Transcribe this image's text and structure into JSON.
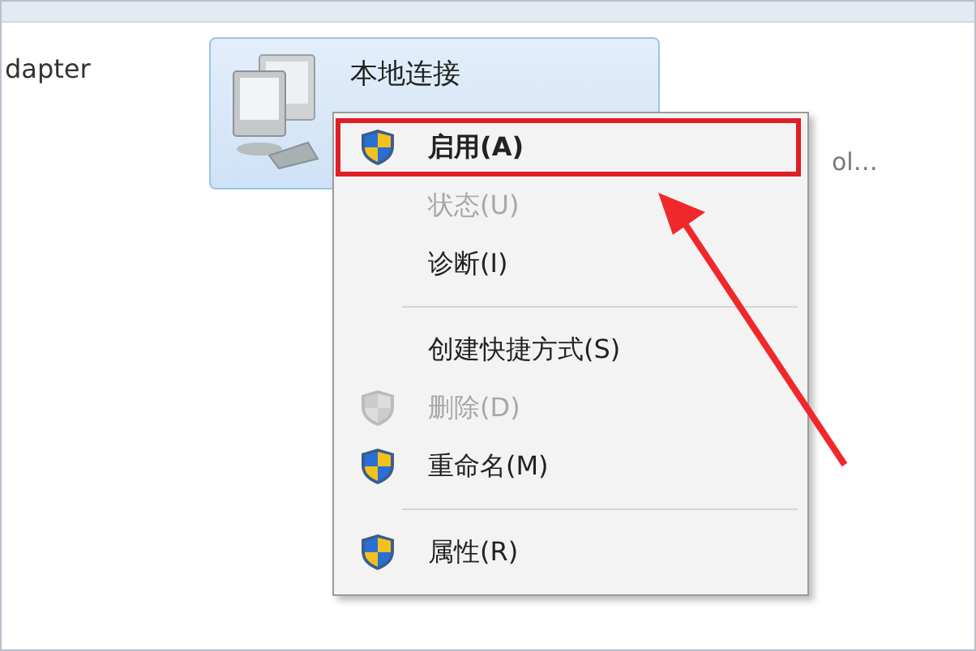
{
  "side_label": "dapter",
  "connection": {
    "name": "本地连接",
    "device": "ol…",
    "selected": true
  },
  "context_menu": {
    "items": [
      {
        "kind": "item",
        "label": "启用(A)",
        "shield": true,
        "default": true,
        "disabled": false,
        "annotated": true
      },
      {
        "kind": "item",
        "label": "状态(U)",
        "shield": false,
        "default": false,
        "disabled": true,
        "annotated": false
      },
      {
        "kind": "item",
        "label": "诊断(I)",
        "shield": false,
        "default": false,
        "disabled": false,
        "annotated": false
      },
      {
        "kind": "separator"
      },
      {
        "kind": "item",
        "label": "创建快捷方式(S)",
        "shield": false,
        "default": false,
        "disabled": false,
        "annotated": false
      },
      {
        "kind": "item",
        "label": "删除(D)",
        "shield": true,
        "default": false,
        "disabled": true,
        "annotated": false
      },
      {
        "kind": "item",
        "label": "重命名(M)",
        "shield": true,
        "default": false,
        "disabled": false,
        "annotated": false
      },
      {
        "kind": "separator"
      },
      {
        "kind": "item",
        "label": "属性(R)",
        "shield": true,
        "default": false,
        "disabled": false,
        "annotated": false
      }
    ]
  }
}
